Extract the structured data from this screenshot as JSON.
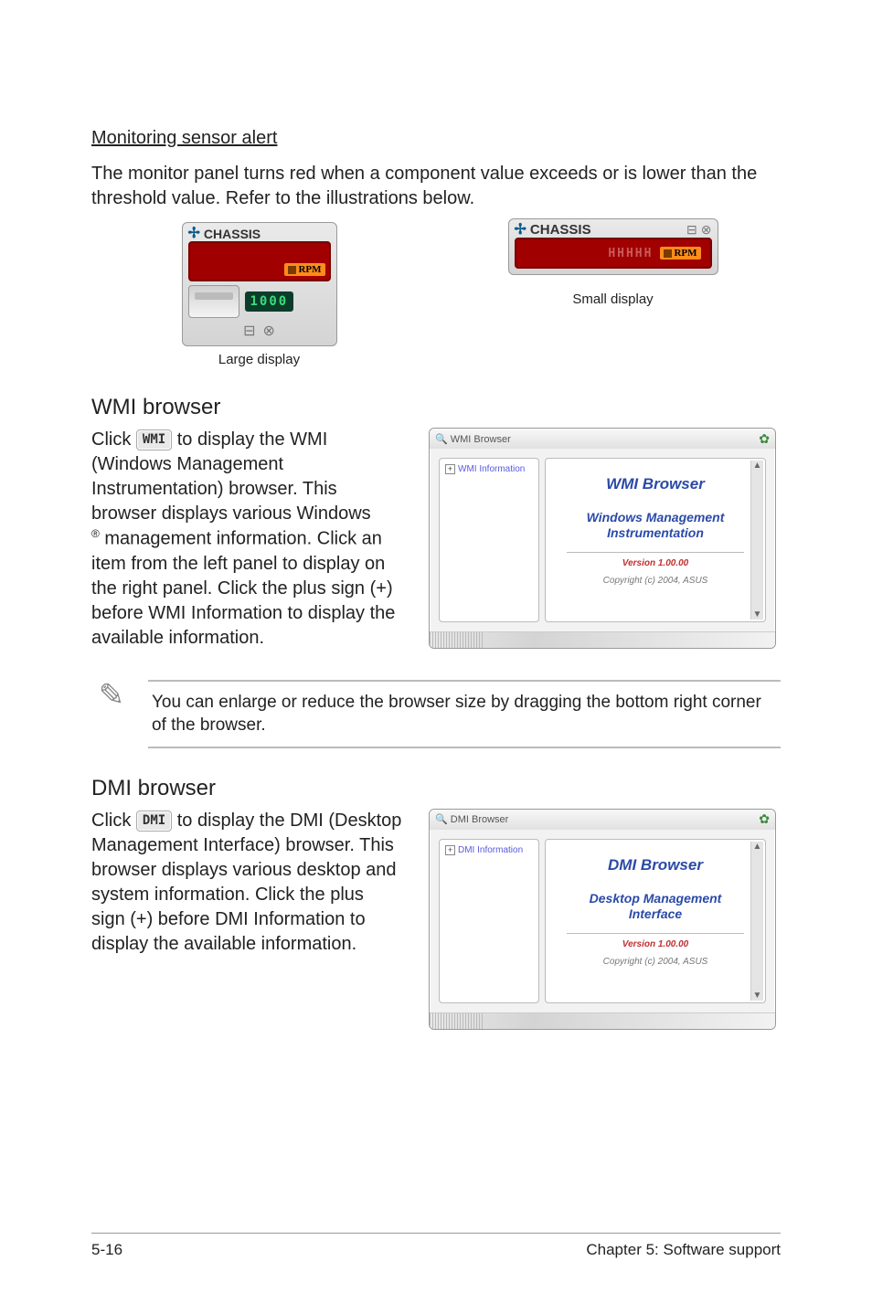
{
  "section_alert_heading": "Monitoring sensor alert",
  "section_alert_body": "The monitor panel turns red when a component value exceeds or is lower than the threshold value. Refer to the illustrations below.",
  "large_display_caption": "Large display",
  "small_display_caption": "Small display",
  "chassis_label": "CHASSIS",
  "rpm_label": "RPM",
  "mini_lcd_value": "1000",
  "segment_placeholder": "HHHHH",
  "wmi_heading": "WMI browser",
  "wmi_click_prefix": "Click ",
  "wmi_button_label": "WMI",
  "wmi_click_suffix_1": " to display the WMI (Windows Management Instrumentation) browser. This browser displays various Windows",
  "wmi_reg": "®",
  "wmi_click_suffix_2": " management information. Click an item from the left panel to display on the right panel. Click the plus sign (+) before WMI Information to display the available information.",
  "wmi_window": {
    "titlebar_icon_label": "WMI Browser",
    "tree_root": "WMI Information",
    "content_title": "WMI  Browser",
    "content_subtitle_line1": "Windows Management",
    "content_subtitle_line2": "Instrumentation",
    "version": "Version 1.00.00",
    "copyright": "Copyright (c) 2004,  ASUS"
  },
  "note_text": "You can enlarge or reduce the browser size by dragging the bottom right corner of the browser.",
  "dmi_heading": "DMI browser",
  "dmi_click_prefix": "Click ",
  "dmi_button_label": "DMI",
  "dmi_click_suffix": " to display the DMI (Desktop Management Interface) browser. This browser displays various desktop and system information. Click the plus sign (+) before DMI Information to display the available information.",
  "dmi_window": {
    "titlebar_icon_label": "DMI Browser",
    "tree_root": "DMI Information",
    "content_title": "DMI  Browser",
    "content_subtitle_line1": "Desktop Management",
    "content_subtitle_line2": "Interface",
    "version": "Version 1.00.00",
    "copyright": "Copyright (c) 2004,  ASUS"
  },
  "footer_left": "5-16",
  "footer_right": "Chapter 5: Software support"
}
